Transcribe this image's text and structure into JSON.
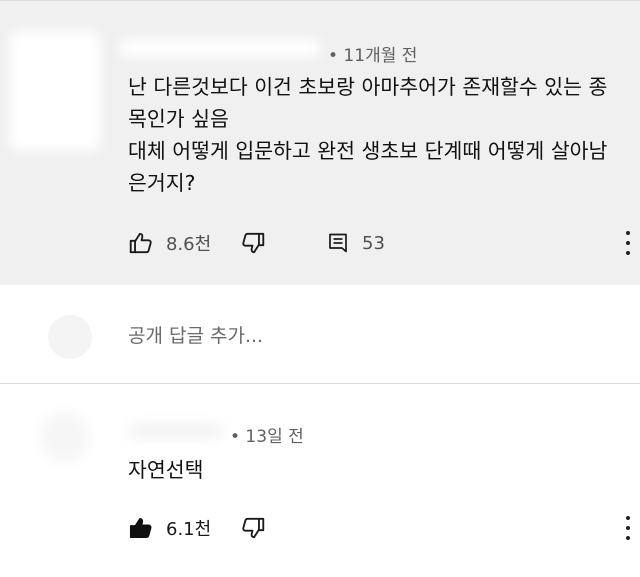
{
  "comments": [
    {
      "meta": "• 11개월 전",
      "lines": [
        "난 다른것보다 이건 초보랑 아마추어가 존재할수 있는 종",
        "목인가 싶음",
        "대체 어떻게 입문하고 완전 생초보 단계때 어떻게 살아남",
        "은거지?"
      ],
      "likes": "8.6천",
      "replies": "53",
      "liked": false
    },
    {
      "meta": "• 13일 전",
      "lines": [
        "자연선택"
      ],
      "likes": "6.1천",
      "liked": true
    }
  ],
  "reply_box": {
    "placeholder": "공개 답글 추가..."
  },
  "icons": {
    "like": "thumbs-up-icon",
    "dislike": "thumbs-down-icon",
    "replies": "comment-icon",
    "more": "more-vertical-icon"
  },
  "colors": {
    "card_bg": "#f0f0f0",
    "meta": "#606060",
    "text": "#111111"
  }
}
